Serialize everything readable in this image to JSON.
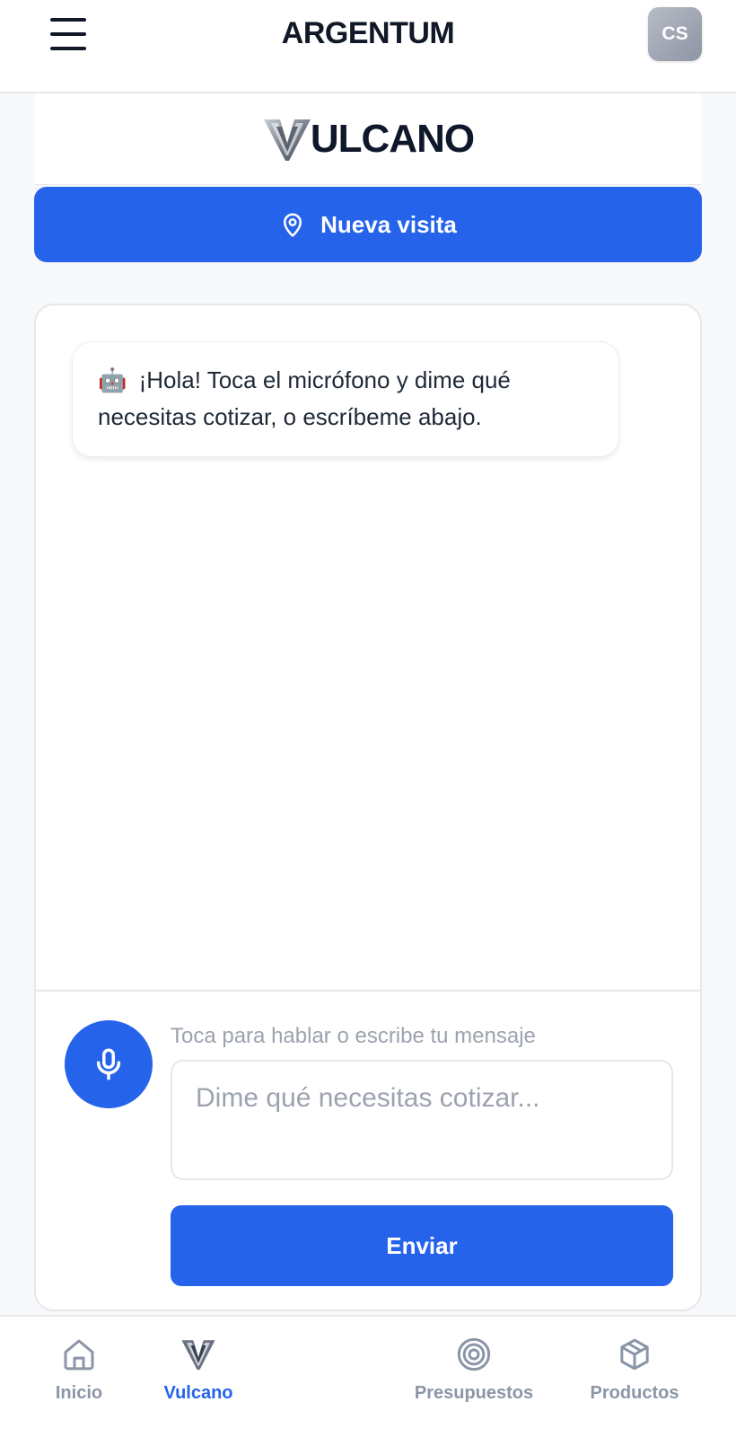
{
  "header": {
    "app_title": "ARGENTUM",
    "avatar_initials": "CS"
  },
  "brand": {
    "name": "ULCANO"
  },
  "actions": {
    "new_visit_label": "Nueva visita"
  },
  "chat": {
    "messages": [
      {
        "sender": "bot",
        "icon": "🤖",
        "text": "¡Hola! Toca el micrófono y dime qué necesitas cotizar, o escríbeme abajo."
      }
    ],
    "hint": "Toca para hablar o escribe tu mensaje",
    "input_placeholder": "Dime qué necesitas cotizar...",
    "input_value": "",
    "send_label": "Enviar"
  },
  "bottom_nav": {
    "items": [
      {
        "label": "Inicio",
        "icon": "home-icon",
        "active": false
      },
      {
        "label": "Vulcano",
        "icon": "vulcano-logo-icon",
        "active": true
      },
      {
        "label": "Presupuestos",
        "icon": "target-icon",
        "active": false
      },
      {
        "label": "Productos",
        "icon": "box-icon",
        "active": false
      }
    ]
  },
  "colors": {
    "primary": "#2563eb",
    "text_dark": "#111827",
    "muted": "#8b95a7",
    "border": "#e5e7eb"
  }
}
